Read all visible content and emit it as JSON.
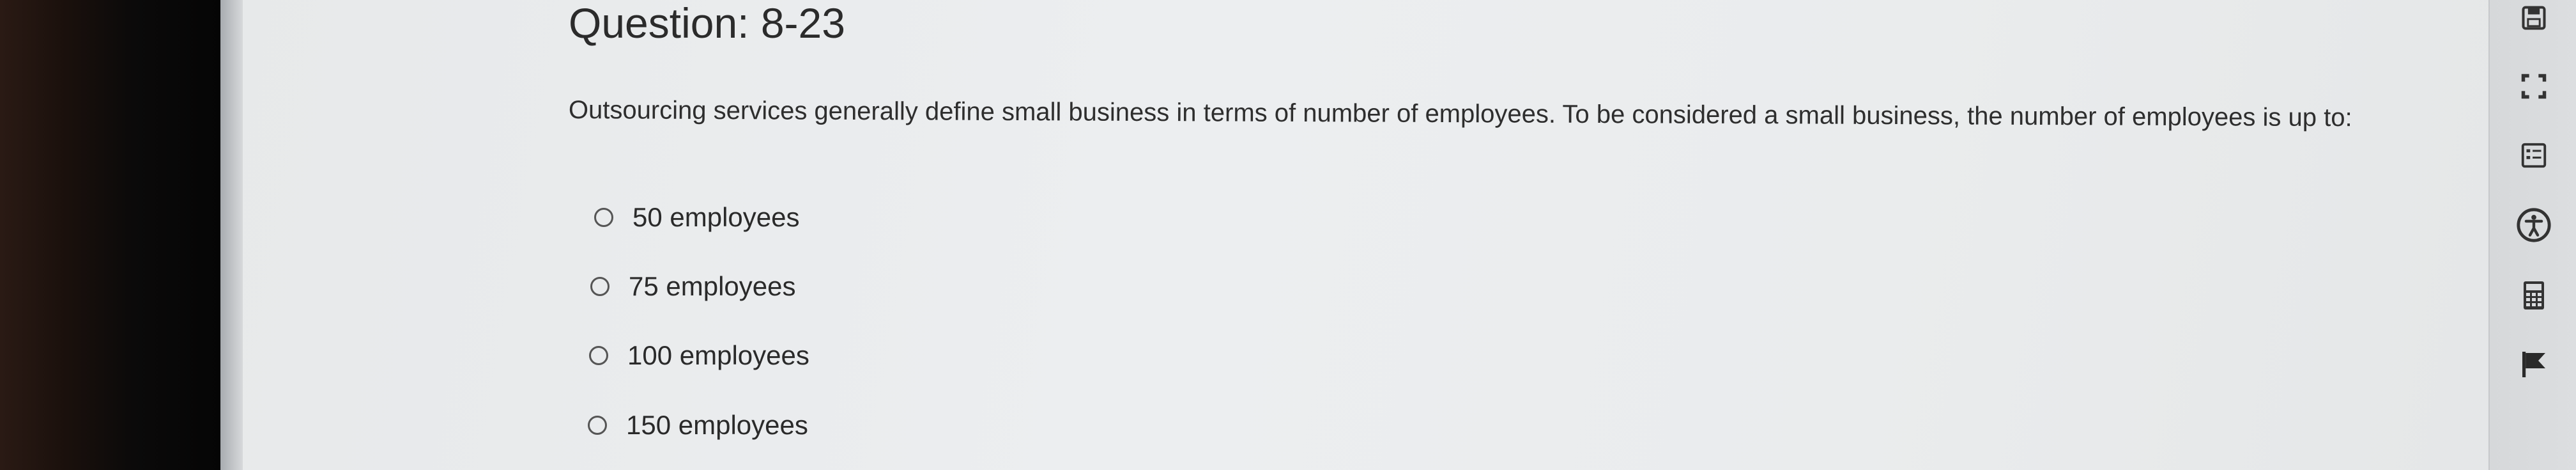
{
  "question": {
    "title": "Question: 8-23",
    "text": "Outsourcing services generally define small business in terms of number of employees. To be considered a small business, the number of employees is up to:"
  },
  "options": [
    {
      "label": "50 employees"
    },
    {
      "label": "75 employees"
    },
    {
      "label": "100 employees"
    },
    {
      "label": "150 employees"
    }
  ],
  "toolbar": {
    "tools": [
      "save-icon",
      "fullscreen-icon",
      "notes-icon",
      "accessibility-icon",
      "calculator-icon",
      "flag-icon"
    ]
  },
  "colors": {
    "background": "#eceef0",
    "text": "#2b2b2b",
    "toolbar": "#d8dadc",
    "icon": "#3a3a3a"
  }
}
